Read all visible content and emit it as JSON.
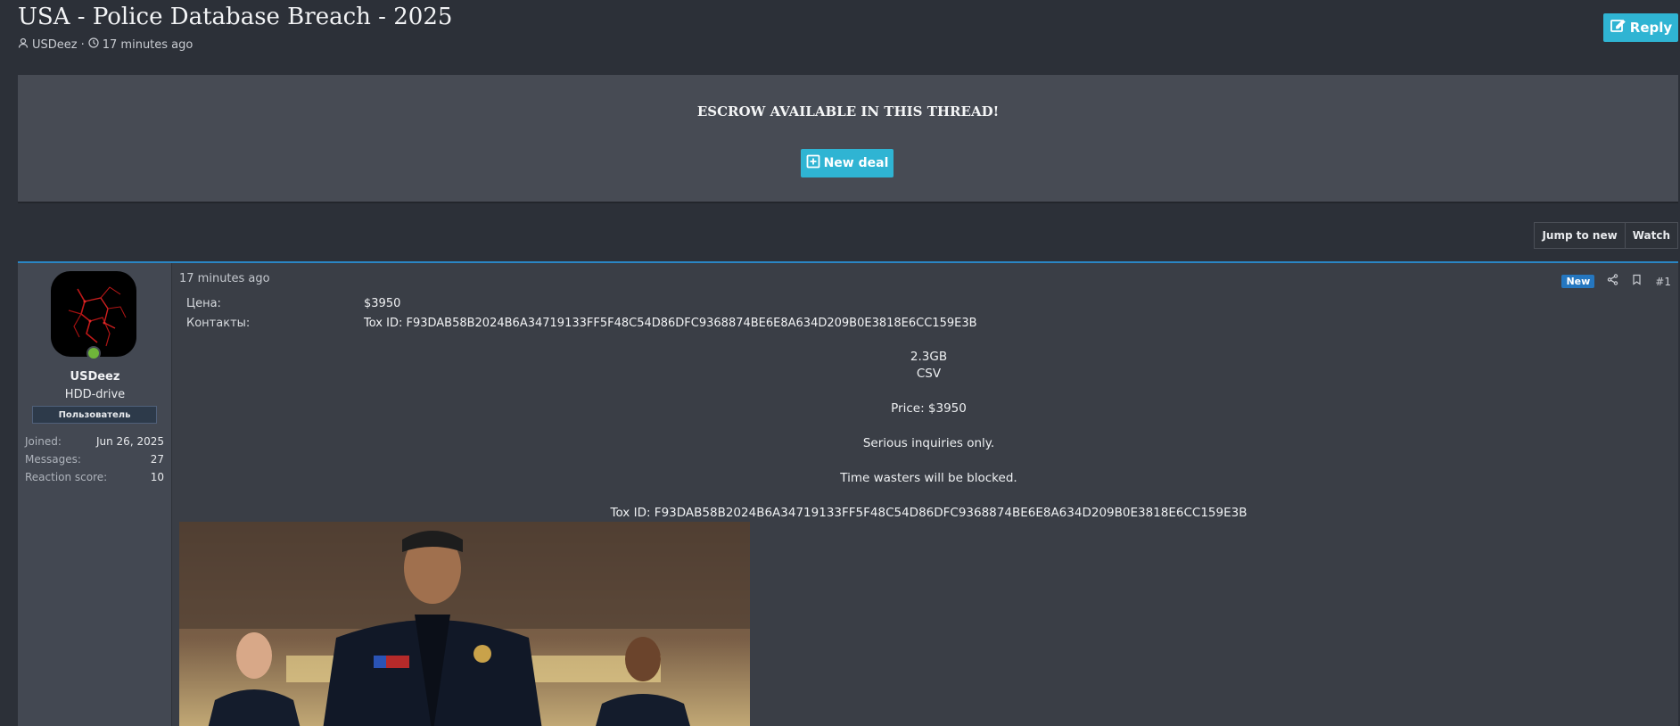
{
  "thread": {
    "title": "USA - Police Database Breach - 2025",
    "author": "USDeez",
    "time": "17 minutes ago",
    "reply_label": "Reply"
  },
  "escrow": {
    "title": "ESCROW AVAILABLE IN THIS THREAD!",
    "button_label": "New deal"
  },
  "toolbar": {
    "jump_label": "Jump to new",
    "watch_label": "Watch"
  },
  "user": {
    "name": "USDeez",
    "title": "HDD-drive",
    "banner": "Пользователь",
    "stats": [
      {
        "key": "Joined:",
        "value": "Jun 26, 2025"
      },
      {
        "key": "Messages:",
        "value": "27"
      },
      {
        "key": "Reaction score:",
        "value": "10"
      }
    ]
  },
  "post": {
    "time": "17 minutes ago",
    "badge": "New",
    "number": "#1",
    "fields": [
      {
        "key": "Цена:",
        "value": "$3950"
      },
      {
        "key": "Контакты:",
        "value": "Tox ID: F93DAB58B2024B6A34719133FF5F48C54D86DFC9368874BE6E8A634D209B0E3818E6CC159E3B"
      }
    ],
    "lines": [
      "2.3GB",
      "CSV",
      "Price: $3950",
      "Serious inquiries only.",
      "Time wasters will be blocked.",
      "Tox ID: F93DAB58B2024B6A34719133FF5F48C54D86DFC9368874BE6E8A634D209B0E3818E6CC159E3B"
    ]
  },
  "colors": {
    "accent": "#2fb4d3",
    "new_badge": "#2577c0",
    "online": "#6fb53a",
    "post_border": "#2a86c4"
  }
}
